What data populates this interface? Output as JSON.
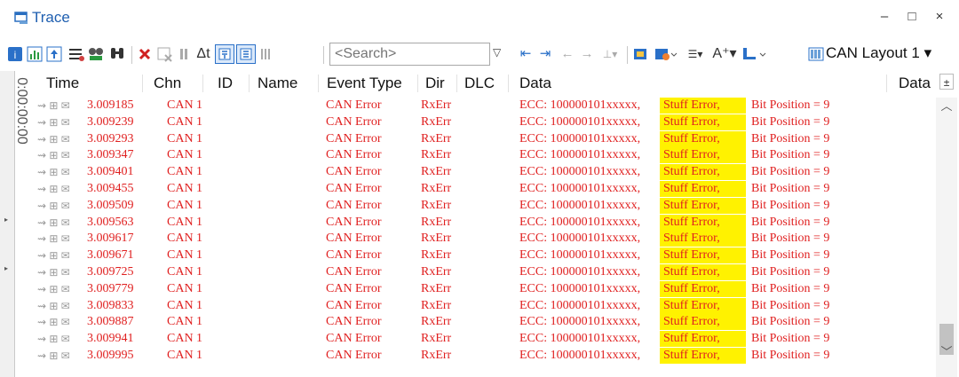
{
  "window": {
    "title": "Trace",
    "minimize": "–",
    "maximize": "□",
    "close": "×"
  },
  "toolbar": {
    "search_placeholder": "<Search>",
    "delta_t": "Δt",
    "layout": "CAN Layout 1"
  },
  "side": {
    "time_label": "0:00:00:00"
  },
  "table": {
    "columns": [
      "Time",
      "Chn",
      "ID",
      "Name",
      "Event Type",
      "Dir",
      "DLC",
      "Data"
    ],
    "right_header": "Data",
    "rows": [
      {
        "time": "3.009185",
        "chn": "CAN 1",
        "event": "CAN Error",
        "dir": "RxErr",
        "data_pre": "ECC: 100000101xxxxx,",
        "data_hl": "Stuff Error,",
        "data_post": "Bit Position = 9"
      },
      {
        "time": "3.009239",
        "chn": "CAN 1",
        "event": "CAN Error",
        "dir": "RxErr",
        "data_pre": "ECC: 100000101xxxxx,",
        "data_hl": "Stuff Error,",
        "data_post": "Bit Position = 9"
      },
      {
        "time": "3.009293",
        "chn": "CAN 1",
        "event": "CAN Error",
        "dir": "RxErr",
        "data_pre": "ECC: 100000101xxxxx,",
        "data_hl": "Stuff Error,",
        "data_post": "Bit Position = 9"
      },
      {
        "time": "3.009347",
        "chn": "CAN 1",
        "event": "CAN Error",
        "dir": "RxErr",
        "data_pre": "ECC: 100000101xxxxx,",
        "data_hl": "Stuff Error,",
        "data_post": "Bit Position = 9"
      },
      {
        "time": "3.009401",
        "chn": "CAN 1",
        "event": "CAN Error",
        "dir": "RxErr",
        "data_pre": "ECC: 100000101xxxxx,",
        "data_hl": "Stuff Error,",
        "data_post": "Bit Position = 9"
      },
      {
        "time": "3.009455",
        "chn": "CAN 1",
        "event": "CAN Error",
        "dir": "RxErr",
        "data_pre": "ECC: 100000101xxxxx,",
        "data_hl": "Stuff Error,",
        "data_post": "Bit Position = 9"
      },
      {
        "time": "3.009509",
        "chn": "CAN 1",
        "event": "CAN Error",
        "dir": "RxErr",
        "data_pre": "ECC: 100000101xxxxx,",
        "data_hl": "Stuff Error,",
        "data_post": "Bit Position = 9"
      },
      {
        "time": "3.009563",
        "chn": "CAN 1",
        "event": "CAN Error",
        "dir": "RxErr",
        "data_pre": "ECC: 100000101xxxxx,",
        "data_hl": "Stuff Error,",
        "data_post": "Bit Position = 9"
      },
      {
        "time": "3.009617",
        "chn": "CAN 1",
        "event": "CAN Error",
        "dir": "RxErr",
        "data_pre": "ECC: 100000101xxxxx,",
        "data_hl": "Stuff Error,",
        "data_post": "Bit Position = 9"
      },
      {
        "time": "3.009671",
        "chn": "CAN 1",
        "event": "CAN Error",
        "dir": "RxErr",
        "data_pre": "ECC: 100000101xxxxx,",
        "data_hl": "Stuff Error,",
        "data_post": "Bit Position = 9"
      },
      {
        "time": "3.009725",
        "chn": "CAN 1",
        "event": "CAN Error",
        "dir": "RxErr",
        "data_pre": "ECC: 100000101xxxxx,",
        "data_hl": "Stuff Error,",
        "data_post": "Bit Position = 9"
      },
      {
        "time": "3.009779",
        "chn": "CAN 1",
        "event": "CAN Error",
        "dir": "RxErr",
        "data_pre": "ECC: 100000101xxxxx,",
        "data_hl": "Stuff Error,",
        "data_post": "Bit Position = 9"
      },
      {
        "time": "3.009833",
        "chn": "CAN 1",
        "event": "CAN Error",
        "dir": "RxErr",
        "data_pre": "ECC: 100000101xxxxx,",
        "data_hl": "Stuff Error,",
        "data_post": "Bit Position = 9"
      },
      {
        "time": "3.009887",
        "chn": "CAN 1",
        "event": "CAN Error",
        "dir": "RxErr",
        "data_pre": "ECC: 100000101xxxxx,",
        "data_hl": "Stuff Error,",
        "data_post": "Bit Position = 9"
      },
      {
        "time": "3.009941",
        "chn": "CAN 1",
        "event": "CAN Error",
        "dir": "RxErr",
        "data_pre": "ECC: 100000101xxxxx,",
        "data_hl": "Stuff Error,",
        "data_post": "Bit Position = 9"
      },
      {
        "time": "3.009995",
        "chn": "CAN 1",
        "event": "CAN Error",
        "dir": "RxErr",
        "data_pre": "ECC: 100000101xxxxx,",
        "data_hl": "Stuff Error,",
        "data_post": "Bit Position = 9"
      }
    ]
  },
  "colors": {
    "error_text": "#e02020",
    "highlight": "#fff200",
    "title": "#1f5fb0"
  }
}
